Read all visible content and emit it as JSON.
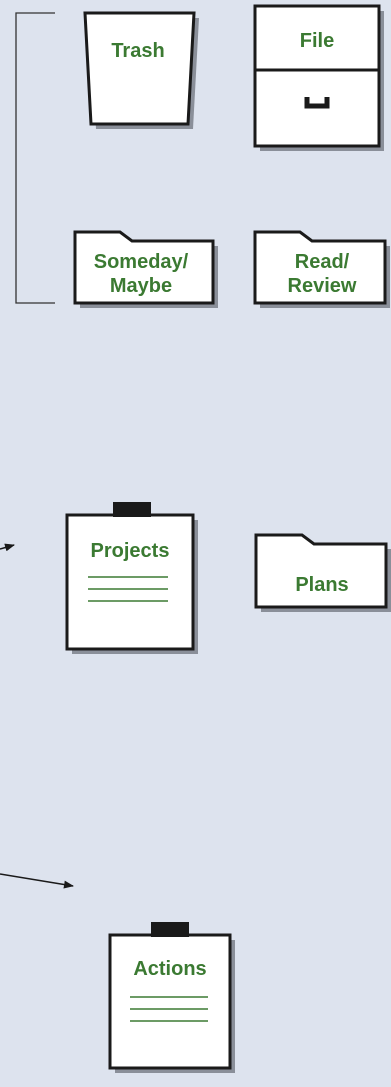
{
  "colors": {
    "background": "#dde3ee",
    "label": "#3b7a32",
    "outline": "#1a1a1a",
    "shadow": "#8a8f99",
    "fill": "#ffffff"
  },
  "nodes": {
    "trash": {
      "label": "Trash"
    },
    "file": {
      "label": "File"
    },
    "someday": {
      "line1": "Someday/",
      "line2": "Maybe"
    },
    "read_review": {
      "line1": "Read/",
      "line2": "Review"
    },
    "projects": {
      "label": "Projects"
    },
    "plans": {
      "label": "Plans"
    },
    "actions": {
      "label": "Actions"
    }
  },
  "icons": {
    "trash": "trash-bin-icon",
    "file": "file-cabinet-icon",
    "someday": "folder-icon",
    "read_review": "folder-icon",
    "projects": "clipboard-icon",
    "plans": "folder-icon",
    "actions": "clipboard-icon"
  }
}
